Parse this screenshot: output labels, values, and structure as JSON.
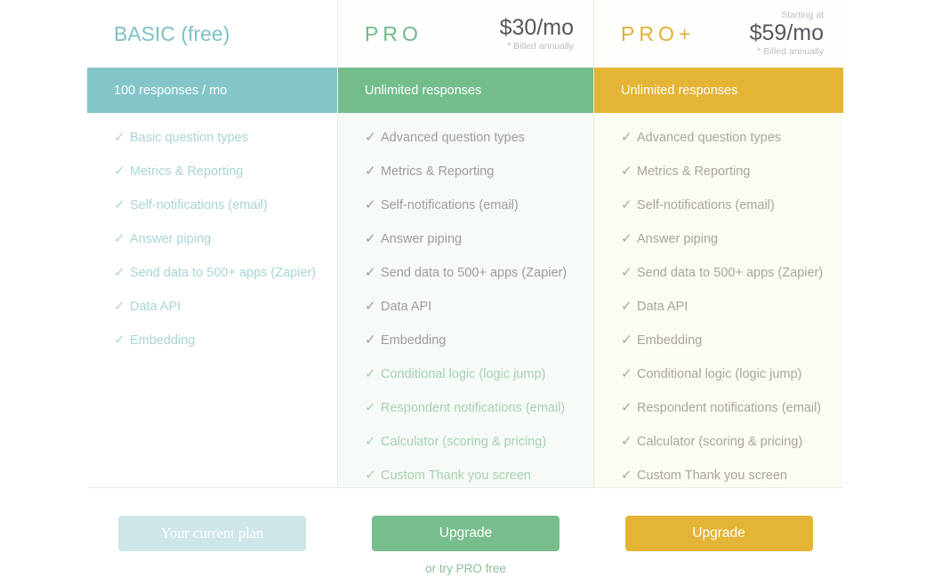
{
  "plans": [
    {
      "id": "basic",
      "name": "BASIC (free)",
      "starting_at": "",
      "price": "",
      "billed_note": "",
      "responses": "100 responses / mo",
      "accent": "#83c5c8",
      "features": [
        "Basic question types",
        "Metrics & Reporting",
        "Self-notifications (email)",
        "Answer piping",
        "Send data to 500+ apps (Zapier)",
        "Data API",
        "Embedding"
      ],
      "cta_label": "Your current plan",
      "secondary_label": ""
    },
    {
      "id": "pro",
      "name": "PRO",
      "starting_at": "",
      "price": "$30/mo",
      "billed_note": "* Billed annually",
      "responses": "Unlimited responses",
      "accent": "#73bd8c",
      "features": [
        "Advanced question types",
        "Metrics & Reporting",
        "Self-notifications (email)",
        "Answer piping",
        "Send data to 500+ apps (Zapier)",
        "Data API",
        "Embedding",
        "Conditional logic (logic jump)",
        "Respondent notifications (email)",
        "Calculator (scoring & pricing)",
        "Custom Thank you screen"
      ],
      "cta_label": "Upgrade",
      "secondary_label": "or try PRO free"
    },
    {
      "id": "proplus",
      "name": "PRO+",
      "starting_at": "Starting at",
      "price": "$59/mo",
      "billed_note": "* Billed annually",
      "responses": "Unlimited responses",
      "accent": "#e3b435",
      "features": [
        "Advanced question types",
        "Metrics & Reporting",
        "Self-notifications (email)",
        "Answer piping",
        "Send data to 500+ apps (Zapier)",
        "Data API",
        "Embedding",
        "Conditional logic (logic jump)",
        "Respondent notifications (email)",
        "Calculator (scoring & pricing)",
        "Custom Thank you screen"
      ],
      "cta_label": "Upgrade",
      "secondary_label": ""
    }
  ],
  "icons": {
    "check": "✓"
  }
}
